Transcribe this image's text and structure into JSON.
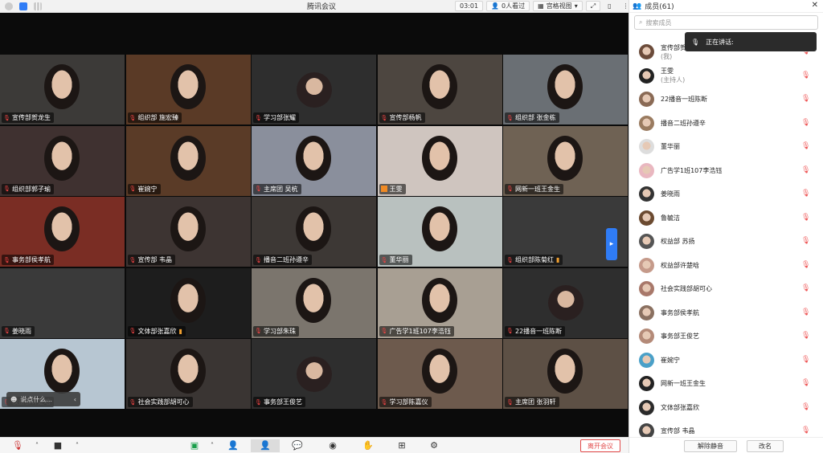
{
  "window": {
    "title": "腾讯会议",
    "timer": "03:01",
    "viewers": "0人看过",
    "view_mode": "宫格视图"
  },
  "grid": {
    "tiles": [
      {
        "label": "宣传部贺龙生",
        "bg": "#3c3a38"
      },
      {
        "label": "组织部 施宏臻",
        "bg": "#5a3a26"
      },
      {
        "label": "学习部张耀",
        "bg": "#2e2e2e",
        "avatar": true
      },
      {
        "label": "宣传部杨帆",
        "bg": "#4d4640"
      },
      {
        "label": "组织部 张金栋",
        "bg": "#6a6f74"
      },
      {
        "label": "组织部郭子瑜",
        "bg": "#3f3130"
      },
      {
        "label": "崔婉宁",
        "bg": "#5a3b27"
      },
      {
        "label": "主席团 吴杭",
        "bg": "#8a8f9c"
      },
      {
        "label": "王雯",
        "bg": "#cfc5bf",
        "host": true
      },
      {
        "label": "网新一班王金生",
        "bg": "#6f6254"
      },
      {
        "label": "事务部侯孝航",
        "bg": "#7a2d24"
      },
      {
        "label": "宣传部 韦晶",
        "bg": "#3d3432"
      },
      {
        "label": "播音二班孙遵辛",
        "bg": "#3d3835"
      },
      {
        "label": "董华丽",
        "bg": "#b9c1bf"
      },
      {
        "label": "组织部陈菊红",
        "bg": "#3a3a3a",
        "signal": true
      },
      {
        "label": "姜晓雨",
        "bg": "#3a3a3a"
      },
      {
        "label": "文体部张嘉欣",
        "bg": "#1d1d1d",
        "signal": true
      },
      {
        "label": "学习部朱珠",
        "bg": "#7b756d"
      },
      {
        "label": "广告学1班107李浩钰",
        "bg": "#a89f93"
      },
      {
        "label": "22播音一班陈断",
        "bg": "#2e2e2e",
        "avatar": true
      },
      {
        "label": "权益部许楚晗",
        "bg": "#b7c6d2"
      },
      {
        "label": "社会实践部胡可心",
        "bg": "#3a3533"
      },
      {
        "label": "事务部王俊艺",
        "bg": "#2e2e2e",
        "avatar": true
      },
      {
        "label": "学习部陈嘉仪",
        "bg": "#6d5a4d"
      },
      {
        "label": "主席团 张羽轩",
        "bg": "#5d5045"
      }
    ],
    "typing_placeholder": "说点什么..."
  },
  "toolbar": {
    "leave_label": "离开会议"
  },
  "panel": {
    "title": "成员(61)",
    "search_placeholder": "搜索成员",
    "speaking_label": "正在讲话:",
    "unmute_button": "解除静音",
    "rename_button": "改名",
    "members": [
      {
        "name": "宣传部贺",
        "sub": "(我)",
        "color": "#6b4b3a"
      },
      {
        "name": "王雯",
        "sub": "(主持人)",
        "color": "#222"
      },
      {
        "name": "22播音一班陈断",
        "color": "#8a6a55"
      },
      {
        "name": "播音二班孙遵辛",
        "color": "#9a7b60"
      },
      {
        "name": "董华丽",
        "color": "#ddd"
      },
      {
        "name": "广告学1班107李浩钰",
        "color": "#e9b7c0"
      },
      {
        "name": "姜晓雨",
        "color": "#333"
      },
      {
        "name": "鲁毓洁",
        "color": "#6b4a30"
      },
      {
        "name": "权益部 苏扬",
        "color": "#555"
      },
      {
        "name": "权益部许楚晗",
        "color": "#c59a8a"
      },
      {
        "name": "社会实践部胡可心",
        "color": "#a8786a"
      },
      {
        "name": "事务部侯孝航",
        "color": "#8a7060"
      },
      {
        "name": "事务部王俊艺",
        "color": "#b48a78"
      },
      {
        "name": "崔婉宁",
        "color": "#4aa0c8"
      },
      {
        "name": "网新一班王金生",
        "color": "#222"
      },
      {
        "name": "文体部张嘉欣",
        "color": "#2a2a2a"
      },
      {
        "name": "宣传部 韦晶",
        "color": "#444"
      }
    ]
  }
}
